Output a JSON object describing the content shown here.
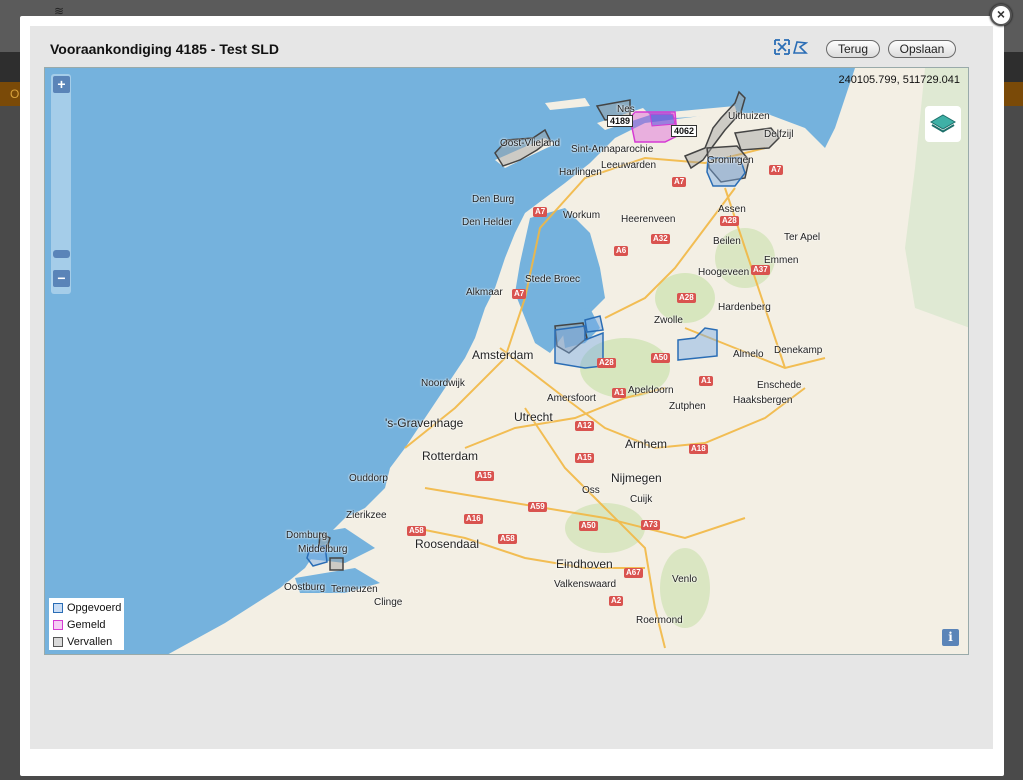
{
  "background": {
    "orange_bar_text": "Ol"
  },
  "modal": {
    "title": "Vooraankondiging 4185 - Test SLD",
    "close_glyph": "×",
    "tools": [
      {
        "name": "fit-extent-icon",
        "glyph": "⛶"
      },
      {
        "name": "draw-polygon-icon",
        "glyph": "⟡"
      }
    ],
    "buttons": {
      "back": "Terug",
      "save": "Opslaan"
    }
  },
  "map": {
    "coordinates": "240105.799, 511729.041",
    "zoom_in": "+",
    "zoom_out": "−",
    "info": "i",
    "layers_icon": "layers-icon",
    "colors": {
      "sea": "#75b2dd",
      "land": "#f3efe4",
      "green": "#cfe3b4",
      "opgevoerd": "#2a6db5",
      "gemeld": "#d63ad3",
      "vervallen": "#555555"
    },
    "legend": [
      {
        "label": "Opgevoerd",
        "color": "#2a6db5"
      },
      {
        "label": "Gemeld",
        "color": "#d63ad3"
      },
      {
        "label": "Vervallen",
        "color": "#555555"
      }
    ],
    "tags": [
      "4189",
      "4062"
    ],
    "cities": {
      "oost_vlieland": "Oost-Vlieland",
      "sint_annaparochie": "Sint-Annaparochie",
      "nes": "Nes",
      "uithuizen": "Uithuizen",
      "delfzijl": "Delfzijl",
      "harlingen": "Harlingen",
      "leeuwarden": "Leeuwarden",
      "groningen": "Groningen",
      "den_burg": "Den Burg",
      "den_helder": "Den Helder",
      "workum": "Workum",
      "heerenveen": "Heerenveen",
      "assen": "Assen",
      "beilen": "Beilen",
      "ter_apel": "Ter Apel",
      "emmen": "Emmen",
      "hoogeveen": "Hoogeveen",
      "stede_broec": "Stede Broec",
      "alkmaar": "Alkmaar",
      "hardenberg": "Hardenberg",
      "zwolle": "Zwolle",
      "amsterdam": "Amsterdam",
      "almelo": "Almelo",
      "denekamp": "Denekamp",
      "noordwijk": "Noordwijk",
      "apeldoorn": "Apeldoorn",
      "enschede": "Enschede",
      "amersfoort": "Amersfoort",
      "zutphen": "Zutphen",
      "haaksbergen": "Haaksbergen",
      "gravenhage": "'s-Gravenhage",
      "utrecht": "Utrecht",
      "arnhem": "Arnhem",
      "rotterdam": "Rotterdam",
      "ouddorp": "Ouddorp",
      "nijmegen": "Nijmegen",
      "oss": "Oss",
      "cuijk": "Cuijk",
      "zierikzee": "Zierikzee",
      "domburg": "Domburg",
      "roosendaal": "Roosendaal",
      "middelburg": "Middelburg",
      "eindhoven": "Eindhoven",
      "valkenswaard": "Valkenswaard",
      "venlo": "Venlo",
      "oostburg": "Oostburg",
      "terneuzen": "Terneuzen",
      "clinge": "Clinge",
      "roermond": "Roermond"
    },
    "roads": {
      "a7_north": "A7",
      "a7_east": "A7",
      "a7_east2": "A7",
      "a7_west": "A7",
      "a28_n": "A28",
      "a6": "A6",
      "a32": "A32",
      "a37": "A37",
      "a7_alkmaar": "A7",
      "a28_mid": "A28",
      "a50": "A50",
      "a1": "A1",
      "a28_s": "A28",
      "a1_b": "A1",
      "a12": "A12",
      "a15": "A15",
      "a18": "A18",
      "a15_w": "A15",
      "a59": "A59",
      "a16": "A16",
      "a58": "A58",
      "a58_w": "A58",
      "a50_s": "A50",
      "a73": "A73",
      "a67": "A67",
      "a2": "A2"
    }
  }
}
